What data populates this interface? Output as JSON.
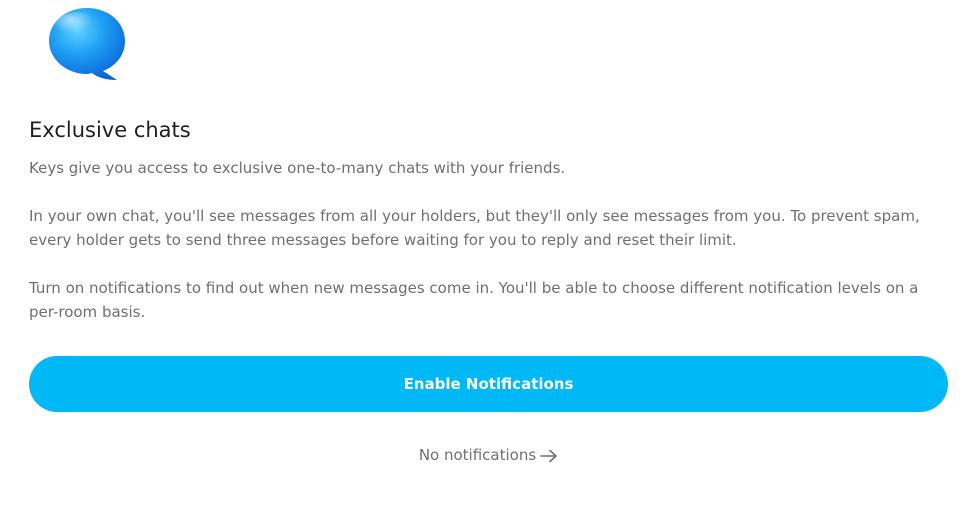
{
  "icon": "chat-bubble-icon",
  "title": "Exclusive chats",
  "paragraphs": [
    "Keys give you access to exclusive one-to-many chats with your friends.",
    "In your own chat, you'll see messages from all your holders, but they'll only see messages from you. To prevent spam, every holder gets to send three messages before waiting for you to reply and reset their limit.",
    "Turn on notifications to find out when new messages come in. You'll be able to choose different notification levels on a per-room basis."
  ],
  "actions": {
    "enable_label": "Enable Notifications",
    "skip_label": "No notifications",
    "skip_icon": "arrow-right-icon"
  },
  "colors": {
    "accent": "#00b8f5",
    "title": "#1f1f1f",
    "body_text": "#6f6f6f"
  }
}
